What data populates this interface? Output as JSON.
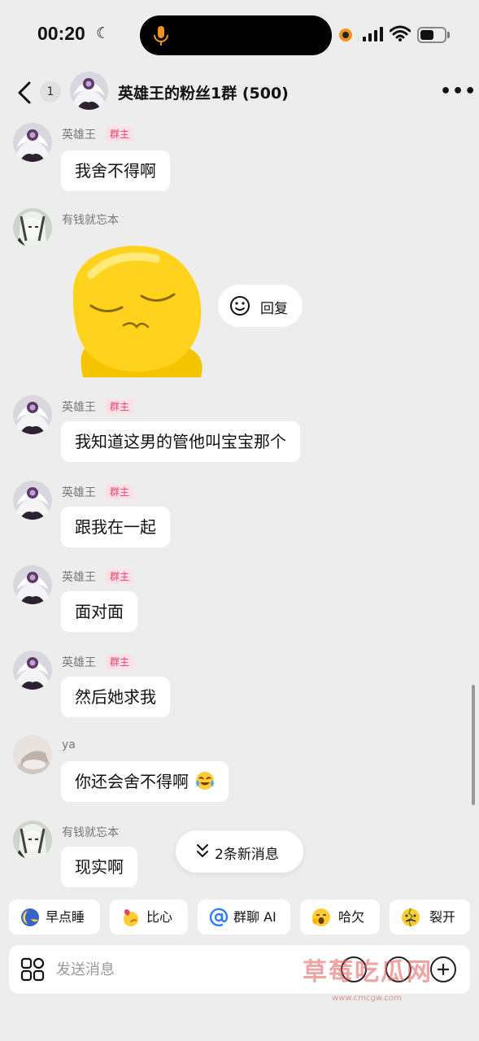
{
  "status_bar": {
    "time": "00:20",
    "icons": [
      "moon-icon",
      "microphone-icon",
      "recording-dot-icon",
      "cellular-signal-icon",
      "wifi-icon",
      "battery-icon"
    ],
    "accent_color": "#f29224"
  },
  "header": {
    "unread_count": "1",
    "group_name": "英雄王的粉丝1群 (500)",
    "more_label": "•••"
  },
  "messages": [
    {
      "sender": "英雄王",
      "badge": "群主",
      "text": "我舍不得啊"
    },
    {
      "sender": "有钱就忘本",
      "badge": "",
      "type": "sticker"
    },
    {
      "sender": "英雄王",
      "badge": "群主",
      "text": "我知道这男的管他叫宝宝那个"
    },
    {
      "sender": "英雄王",
      "badge": "群主",
      "text": "跟我在一起"
    },
    {
      "sender": "英雄王",
      "badge": "群主",
      "text": "面对面"
    },
    {
      "sender": "英雄王",
      "badge": "群主",
      "text": "然后她求我"
    },
    {
      "sender": "ya",
      "badge": "",
      "text": "你还会舍不得啊"
    },
    {
      "sender": "有钱就忘本",
      "badge": "",
      "text": "现实啊"
    }
  ],
  "reply_pill": {
    "label": "回复"
  },
  "new_messages_pill": {
    "label": "2条新消息"
  },
  "quick_replies": [
    {
      "label": "早点睡",
      "icon": "moon-sleep-icon"
    },
    {
      "label": "比心",
      "icon": "heart-hand-icon"
    },
    {
      "label": "群聊 AI",
      "icon": "at-icon"
    },
    {
      "label": "哈欠",
      "icon": "yawn-emoji-icon"
    },
    {
      "label": "裂开",
      "icon": "cracked-emoji-icon"
    }
  ],
  "input": {
    "placeholder": "发送消息"
  },
  "watermark": {
    "text": "草莓吃瓜网",
    "subtext": "www.cmcgw.com"
  },
  "colors": {
    "background": "#ededed",
    "badge_text": "#e8426b",
    "badge_bg": "#fbe0e6"
  }
}
